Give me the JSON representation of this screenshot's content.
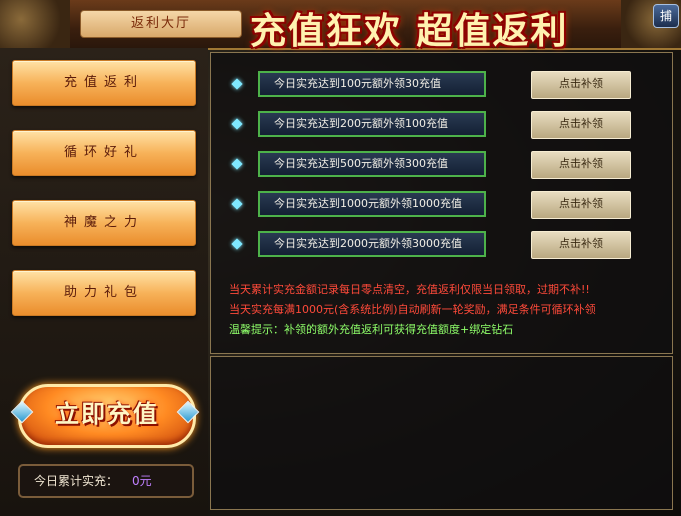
{
  "header": {
    "tab_label": "返利大厅",
    "banner_title": "充值狂欢 超值返利",
    "help_label": "捕"
  },
  "menu": {
    "items": [
      {
        "label": "充值返利"
      },
      {
        "label": "循环好礼"
      },
      {
        "label": "神魔之力"
      },
      {
        "label": "助力礼包"
      }
    ],
    "recharge_button": "立即充值",
    "total_label": "今日累计实充：",
    "total_value": "0元"
  },
  "rewards": {
    "rows": [
      {
        "label": "今日实充达到100元额外领30充值",
        "button": "点击补领"
      },
      {
        "label": "今日实充达到200元额外领100充值",
        "button": "点击补领"
      },
      {
        "label": "今日实充达到500元额外领300充值",
        "button": "点击补领"
      },
      {
        "label": "今日实充达到1000元额外领1000充值",
        "button": "点击补领"
      },
      {
        "label": "今日实充达到2000元额外领3000充值",
        "button": "点击补领"
      }
    ],
    "notes": {
      "line1": "当天累计实充金额记录每日零点清空，充值返利仅限当日领取，过期不补!!",
      "line2": "当天实充每满1000元(含系统比例)自动刷新一轮奖励，满足条件可循环补领",
      "line3": "温馨提示：补领的额外充值返利可获得充值额度+绑定钻石"
    }
  },
  "colors": {
    "accent_green": "#4db24a",
    "note_red": "#ff4a3a",
    "note_green": "#8fff6a",
    "total_value": "#c080ff"
  }
}
